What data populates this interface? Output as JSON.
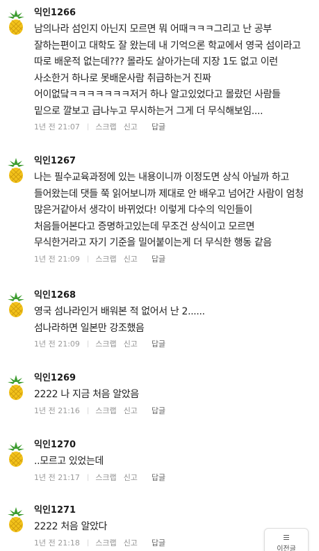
{
  "comments": [
    {
      "author": "익인1266",
      "body": "남의나라 섬인지 아닌지 모르면 뭐 어때ㅋㅋㅋ그리고 난 공부 잘하는편이고 대학도 잘 왔는데 내 기억으론 학교에서 영국 섬이라고 따로 배운적 없는데??? 몰라도 살아가는데 지장 1도 없고 이런 사소한거 하나로 못배운사람 취급하는거 진짜 어이없닼ㅋㅋㅋㅋㅋㅋㅋ저거 하나 알고있었다고 몰랐던 사람들 밑으로 깔보고 급나누고 무시하는거 그게 더 무식해보임....",
      "time": "1년 전 21:07",
      "scrap": "스크랩",
      "report": "신고",
      "reply": "답글"
    },
    {
      "author": "익인1267",
      "body": "나는 필수교육과정에 있는 내용이니까 이정도면 상식 아닐까 하고 들어왔는데 댓들 쭉 읽어보니까 제대로 안 배우고 넘어간 사람이 엄청 많은거같아서 생각이 바뀌었다! 이렇게 다수의 익인들이 처음들어본다고 증명하고있는데 무조건 상식이고 모르면 무식한거라고 자기 기준을 밀어붙이는게 더 무식한 행동 같음",
      "time": "1년 전 21:09",
      "scrap": "스크랩",
      "report": "신고",
      "reply": "답글"
    },
    {
      "author": "익인1268",
      "body": "영국 섬나라인거 배워본 적 없어서 난 2......\n섬나라하면 일본만 강조했음",
      "time": "1년 전 21:09",
      "scrap": "스크랩",
      "report": "신고",
      "reply": "답글"
    },
    {
      "author": "익인1269",
      "body": "2222 나 지금 처음 알았음",
      "time": "1년 전 21:16",
      "scrap": "스크랩",
      "report": "신고",
      "reply": "답글"
    },
    {
      "author": "익인1270",
      "body": "..모르고 있었는데",
      "time": "1년 전 21:17",
      "scrap": "스크랩",
      "report": "신고",
      "reply": "답글"
    },
    {
      "author": "익인1271",
      "body": "2222 처음 알았다",
      "time": "1년 전 21:18",
      "scrap": "스크랩",
      "report": "신고",
      "reply": "답글"
    }
  ],
  "scroll_widget": {
    "label": "이전글",
    "icon": "menu-icon"
  },
  "icons": {
    "avatar": "pineapple-icon"
  },
  "colors": {
    "author": "#1a1a1a",
    "meta": "#9a9a9a",
    "body": "#222222",
    "pineapple_body": "#f2c21b",
    "pineapple_leaf": "#3f9d32"
  }
}
